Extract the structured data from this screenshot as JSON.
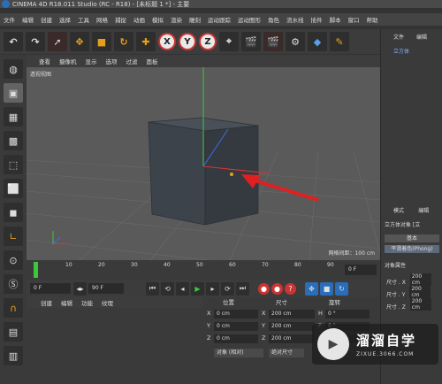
{
  "window": {
    "title": "CINEMA 4D R18.011 Studio (RC - R18) - [未标题 1 *] - 主要"
  },
  "menubar": [
    "文件",
    "编辑",
    "创建",
    "选择",
    "工具",
    "网格",
    "捕捉",
    "动画",
    "模拟",
    "渲染",
    "雕刻",
    "运动跟踪",
    "运动图形",
    "角色",
    "流水线",
    "插件",
    "脚本",
    "窗口",
    "帮助"
  ],
  "toolbar": {
    "x_label": "X",
    "y_label": "Y",
    "z_label": "Z"
  },
  "viewport": {
    "menu": [
      "查看",
      "摄像机",
      "显示",
      "选项",
      "过滤",
      "面板"
    ],
    "label": "透视视图",
    "grid_info": "网格间距：100 cm"
  },
  "timeline": {
    "ticks": [
      "0",
      "10",
      "20",
      "30",
      "40",
      "50",
      "60",
      "70",
      "80",
      "90"
    ],
    "frame": "0 F"
  },
  "playbar": {
    "start": "0 F",
    "end": "90 F"
  },
  "material": {
    "menu": [
      "创建",
      "编辑",
      "功能",
      "纹理"
    ]
  },
  "coords": {
    "headers": {
      "position": "位置",
      "size": "尺寸",
      "rotation": "旋转"
    },
    "axis": {
      "x": "X",
      "y": "Y",
      "z": "Z",
      "h": "H",
      "p": "P",
      "b": "B"
    },
    "position": {
      "x": "0 cm",
      "y": "0 cm",
      "z": "0 cm"
    },
    "size": {
      "x": "200 cm",
      "y": "200 cm",
      "z": "200 cm"
    },
    "rotation": {
      "h": "0 °",
      "p": "0 °",
      "b": "0 °"
    },
    "mode": "对象 (相对)",
    "size_mode": "绝对尺寸"
  },
  "rightpanel": {
    "menu": [
      "文件",
      "编辑"
    ],
    "object": "立方体",
    "attr_menu": [
      "模式",
      "编辑"
    ],
    "object_title": "立方体对象 [立",
    "tab_basic": "基本",
    "tab_phong": "平滑着色(Phong)",
    "section": "对象属性",
    "size_x_label": "尺寸 . X",
    "size_y_label": "尺寸 . Y",
    "size_z_label": "尺寸 . Z",
    "size_x": "200 cm",
    "size_y": "200 cm",
    "size_z": "200 cm"
  },
  "watermark": {
    "name": "溜溜自学",
    "url": "ZIXUE.3066.COM"
  }
}
